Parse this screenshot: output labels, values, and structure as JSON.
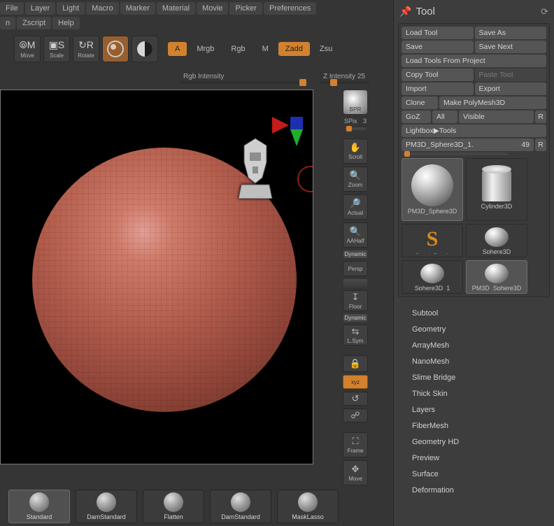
{
  "menu": {
    "row1": [
      "File",
      "Layer",
      "Light",
      "Macro",
      "Marker",
      "Material",
      "Movie",
      "Picker",
      "Preferences"
    ],
    "row2": [
      "n",
      "Zscript",
      "Help"
    ]
  },
  "toolbar": {
    "move": "Move",
    "scale": "Scale",
    "rotate": "Rotate",
    "a": "A",
    "mrgb": "Mrgb",
    "rgb": "Rgb",
    "m": "M",
    "zadd": "Zadd",
    "zsu": "Zsu",
    "rgb_intensity": "Rgb Intensity",
    "z_intensity": "Z Intensity 25"
  },
  "vcol": {
    "bpr": "BPR",
    "spix_label": "SPix",
    "spix_val": "3",
    "scroll": "Scroll",
    "zoom": "Zoom",
    "actual": "Actual",
    "aahalf": "AAHalf",
    "dynamic": "Dynamic",
    "persp": "Persp",
    "floor": "Floor",
    "lsym": "L.Sym",
    "xyz": "xyz",
    "frame": "Frame",
    "move": "Move"
  },
  "brushes": [
    "Standard",
    "DamStandard",
    "Flatten",
    "DamStandard",
    "MaskLasso"
  ],
  "tool_panel": {
    "title": "Tool",
    "buttons": {
      "load": "Load Tool",
      "saveas": "Save As",
      "save": "Save",
      "savenext": "Save Next",
      "loadproj": "Load Tools From Project",
      "copy": "Copy Tool",
      "paste": "Paste Tool",
      "import": "Import",
      "export": "Export",
      "clone": "Clone",
      "makepm": "Make PolyMesh3D",
      "goz": "GoZ",
      "all": "All",
      "visible": "Visible",
      "r": "R",
      "lightbox": "Lightbox▶Tools",
      "current": "PM3D_Sphere3D_1.",
      "curnum": "49"
    },
    "thumbs": [
      {
        "label": "PM3D_Sphere3D",
        "kind": "sph",
        "sel": true
      },
      {
        "label": "Cylinder3D",
        "kind": "cyl"
      },
      {
        "label": "SimpleBrush",
        "kind": "sb"
      },
      {
        "label": "Sphere3D",
        "kind": "sph",
        "small": true
      },
      {
        "label": "Sphere3D_1",
        "kind": "sph",
        "small": true
      },
      {
        "label": "PM3D_Sphere3D",
        "kind": "sph",
        "small": true
      }
    ],
    "subpalettes": [
      "Subtool",
      "Geometry",
      "ArrayMesh",
      "NanoMesh",
      "Slime Bridge",
      "Thick Skin",
      "Layers",
      "FiberMesh",
      "Geometry HD",
      "Preview",
      "Surface",
      "Deformation"
    ]
  }
}
